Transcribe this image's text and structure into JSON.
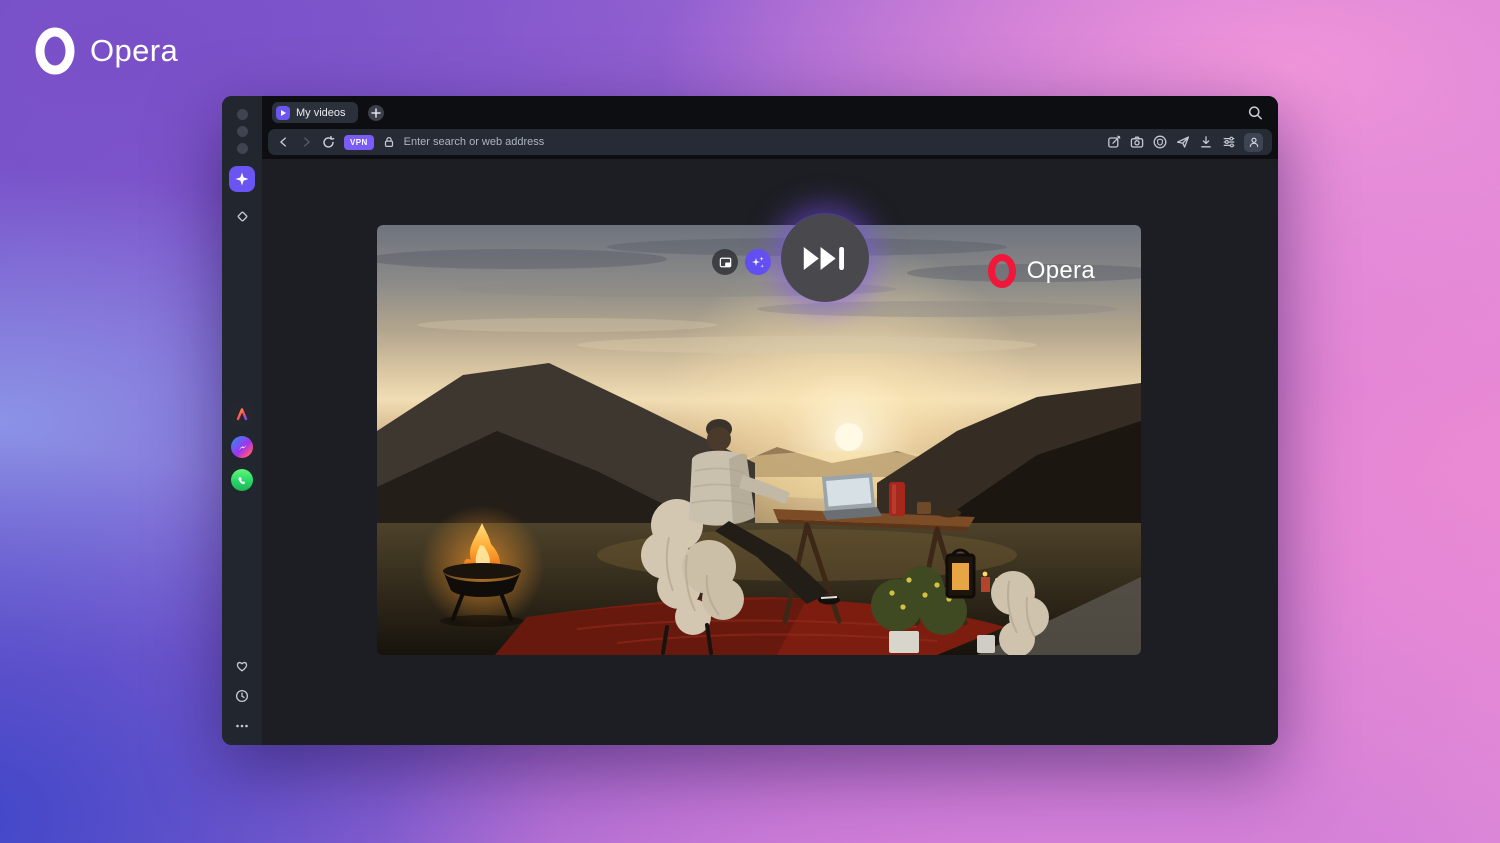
{
  "hero": {
    "brand": "Opera"
  },
  "window": {
    "sidebar": {
      "workspace_dots": 3,
      "icons": [
        "workspace-active-star",
        "workspace-diamond",
        "aria-ai",
        "facebook-messenger",
        "whatsapp",
        "favorites-heart",
        "history-clock",
        "more-ellipsis"
      ]
    },
    "tabstrip": {
      "active_tab_label": "My videos",
      "icons": [
        "video-play-favicon",
        "new-tab-plus",
        "tab-search"
      ]
    },
    "toolbar": {
      "vpn_badge": "VPN",
      "address_placeholder": "Enter search or web address",
      "left_icons": [
        "back-arrow",
        "forward-arrow",
        "reload",
        "vpn-badge",
        "lock"
      ],
      "right_icons": [
        "snapshot-edit",
        "camera",
        "shield-badge",
        "flow-send",
        "download",
        "easy-setup-sliders",
        "profile-person"
      ]
    },
    "video": {
      "watermark_brand": "Opera",
      "overlay_icons": [
        "picture-in-picture",
        "ai-sparkles",
        "skip-to-end"
      ],
      "scene": "person at campfire picnic table with laptop watching mountain sunset"
    }
  },
  "colors": {
    "accent_purple": "#6A55F2",
    "vpn_badge_purple": "#7C5CF6",
    "ai_button_purple": "#6150EF",
    "opera_red": "#F1173A",
    "whatsapp_green": "#25D366",
    "chrome_dark": "#0D0E12",
    "sidebar_gray": "#22262F",
    "content_gray": "#1D1E23"
  }
}
